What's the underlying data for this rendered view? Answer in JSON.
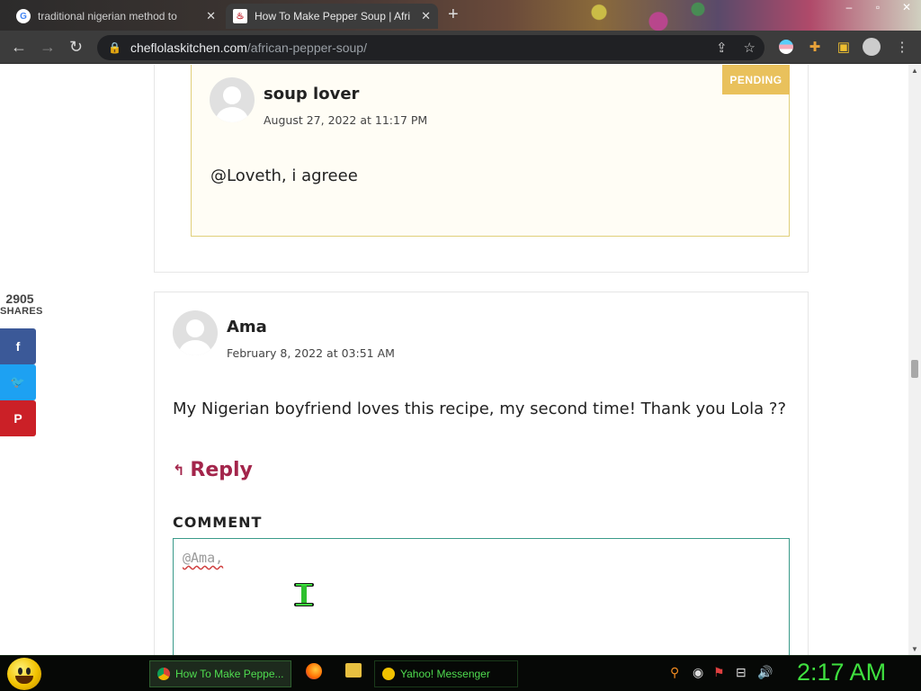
{
  "browser": {
    "tabs": [
      {
        "title": "traditional nigerian method to",
        "active": false
      },
      {
        "title": "How To Make Pepper Soup | Afri",
        "active": true
      }
    ],
    "new_tab_symbol": "+",
    "window_controls": [
      "–",
      "▫",
      "✕"
    ],
    "url_host": "cheflolaskitchen.com",
    "url_path": "/african-pepper-soup/"
  },
  "comments": [
    {
      "name": "soup lover",
      "date": "August 27, 2022 at 11:17 PM",
      "text": "@Loveth, i agreee",
      "badge": "PENDING"
    },
    {
      "name": "Ama",
      "date": "February 8, 2022 at 03:51 AM",
      "text": "My Nigerian boyfriend loves this recipe, my second time! Thank you Lola ??"
    }
  ],
  "reply": {
    "label": "Reply",
    "icon": "reply-arrow-icon"
  },
  "comment_form": {
    "label": "COMMENT",
    "value": "@Ama,"
  },
  "share": {
    "count": "2905",
    "label": "SHARES",
    "buttons": [
      {
        "network": "facebook",
        "glyph": "f",
        "color": "#3b5998"
      },
      {
        "network": "twitter",
        "glyph": "🐦",
        "color": "#1da1f2"
      },
      {
        "network": "pinterest",
        "glyph": "P",
        "color": "#cb2027"
      }
    ]
  },
  "taskbar": {
    "tasks": [
      "How To Make Peppe...",
      "Yahoo! Messenger"
    ],
    "clock": "2:17 AM"
  }
}
